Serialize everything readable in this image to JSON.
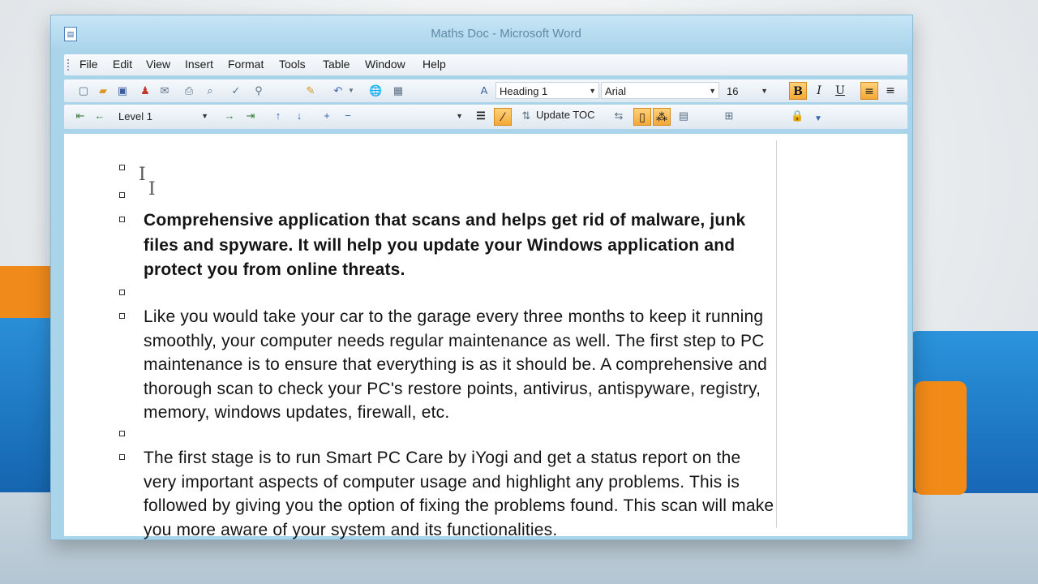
{
  "window": {
    "title": "Maths Doc - Microsoft Word"
  },
  "menu": {
    "items": [
      "File",
      "Edit",
      "View",
      "Insert",
      "Format",
      "Tools",
      "Table",
      "Window",
      "Help"
    ]
  },
  "formatting": {
    "style": "Heading 1",
    "font": "Arial",
    "size": "16",
    "bold_label": "B",
    "italic_label": "I",
    "underline_label": "U"
  },
  "outlining": {
    "level": "Level 1",
    "update_toc_label": "Update TOC"
  },
  "document": {
    "paragraphs": [
      "",
      "",
      "Comprehensive application that scans and helps get rid of malware, junk files and spyware. It will help you update your Windows application and protect you from online threats.",
      "",
      "Like you would take your car to the garage every three months to keep it running smoothly, your computer needs regular maintenance as well. The first step to PC maintenance is to ensure that everything is as it should be. A comprehensive and thorough scan to check your PC's restore points, antivirus, antispyware, registry, memory, windows updates, firewall, etc.",
      "",
      "The first stage is to run Smart PC Care by iYogi and get a status report on the very important aspects of computer usage and highlight any problems. This is followed by giving you the option of fixing the problems found. This scan will make you more aware of your system and its functionalities."
    ]
  },
  "colors": {
    "accent_orange": "#f5a836",
    "title_bar": "#a8d3ea"
  }
}
